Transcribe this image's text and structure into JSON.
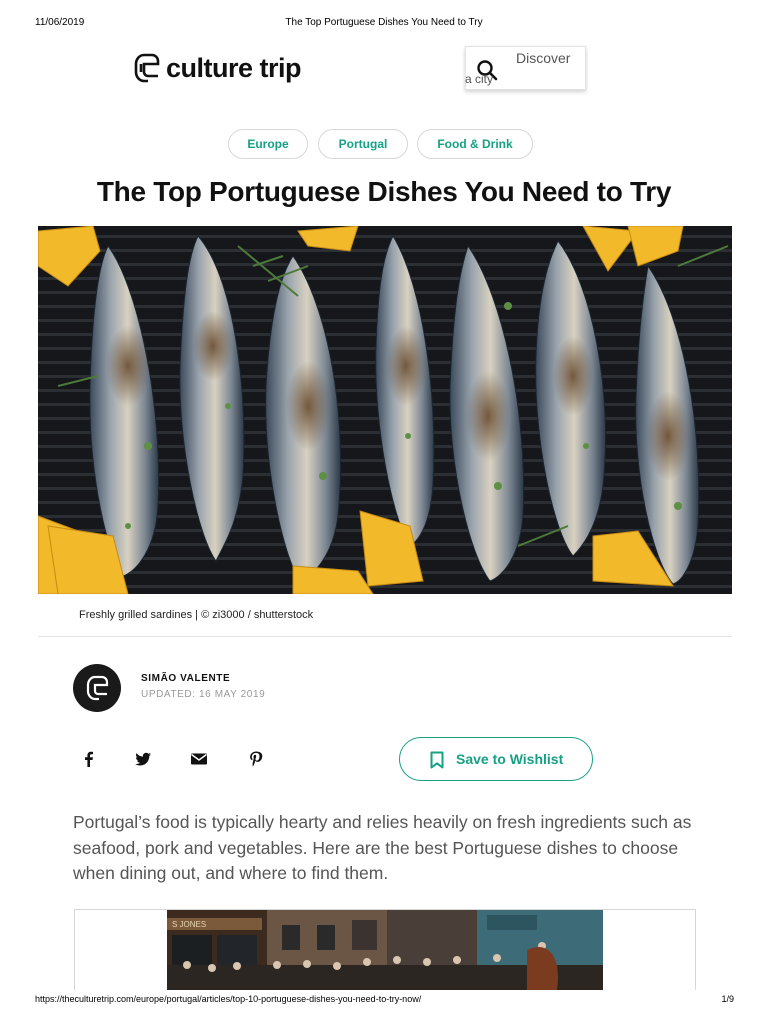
{
  "print": {
    "date": "11/06/2019",
    "title": "The Top Portuguese Dishes You Need to Try",
    "url": "https://theculturetrip.com/europe/portugal/articles/top-10-portuguese-dishes-you-need-to-try-now/",
    "page": "1/9"
  },
  "header": {
    "logo_text": "culture trip",
    "search_line1": "Discover",
    "search_line2": "a city"
  },
  "tags": [
    "Europe",
    "Portugal",
    "Food & Drink"
  ],
  "article": {
    "title": "The Top Portuguese Dishes You Need to Try",
    "hero_caption": "Freshly grilled sardines | © zi3000 / shutterstock",
    "author": "SIMÃO VALENTE",
    "updated": "UPDATED: 16 MAY 2019",
    "wishlist_label": "Save to Wishlist",
    "intro": "Portugal’s food is typically hearty and relies heavily on fresh ingredients such as seafood, pork and vegetables. Here are the best Portuguese dishes to choose when dining out, and where to find them."
  },
  "share_icons": [
    "facebook-icon",
    "twitter-icon",
    "email-icon",
    "pinterest-icon"
  ],
  "colors": {
    "accent": "#16a085",
    "text": "#111111",
    "muted": "#999999"
  }
}
